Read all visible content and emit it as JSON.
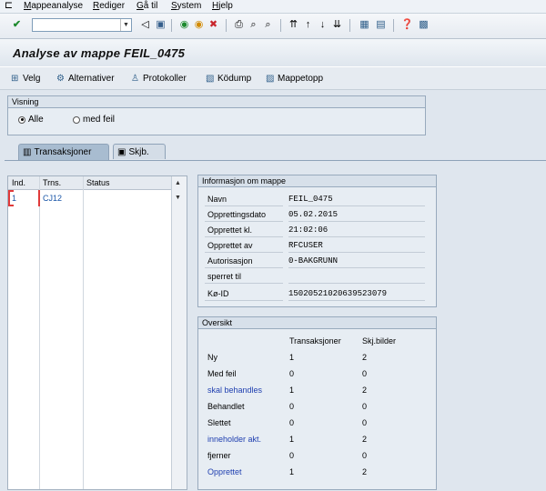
{
  "menu": {
    "items": [
      "Mappeanalyse",
      "Rediger",
      "Gå til",
      "System",
      "Hjelp"
    ]
  },
  "toolbar": {
    "command_value": ""
  },
  "title": "Analyse av mappe FEIL_0475",
  "app_toolbar": {
    "velg": "Velg",
    "alternativer": "Alternativer",
    "protokoller": "Protokoller",
    "kodump": "Ködump",
    "mappetopp": "Mappetopp"
  },
  "visning": {
    "title": "Visning",
    "alle": "Alle",
    "med_feil": "med feil",
    "selected": "Alle"
  },
  "tabs": {
    "transaksjoner": "Transaksjoner",
    "skjb": "Skjb."
  },
  "grid": {
    "headers": [
      "Ind.",
      "Trns.",
      "Status"
    ],
    "rows": [
      {
        "ind": "1",
        "trns": "CJ12",
        "status": ""
      }
    ]
  },
  "info": {
    "title": "Informasjon om mappe",
    "rows": [
      {
        "label": "Navn",
        "value": "FEIL_0475"
      },
      {
        "label": "Opprettingsdato",
        "value": "05.02.2015"
      },
      {
        "label": "Opprettet kl.",
        "value": "21:02:06"
      },
      {
        "label": "Opprettet av",
        "value": "RFCUSER"
      },
      {
        "label": "Autorisasjon",
        "value": "0-BAKGRUNN"
      },
      {
        "label": "sperret til",
        "value": ""
      },
      {
        "label": "Kø-ID",
        "value": "15020521020639523079"
      }
    ]
  },
  "oversikt": {
    "title": "Oversikt",
    "col1": "Transaksjoner",
    "col2": "Skj.bilder",
    "rows": [
      {
        "label": "Ny",
        "t": "1",
        "s": "2",
        "link": false
      },
      {
        "label": "Med feil",
        "t": "0",
        "s": "0",
        "link": false
      },
      {
        "label": "skal behandles",
        "t": "1",
        "s": "2",
        "link": true
      },
      {
        "label": "Behandlet",
        "t": "0",
        "s": "0",
        "link": false
      },
      {
        "label": "Slettet",
        "t": "0",
        "s": "0",
        "link": false
      },
      {
        "label": "inneholder akt.",
        "t": "1",
        "s": "2",
        "link": true
      },
      {
        "label": "fjerner",
        "t": "0",
        "s": "0",
        "link": false
      },
      {
        "label": "Opprettet",
        "t": "1",
        "s": "2",
        "link": true
      }
    ]
  },
  "colors": {
    "link": "#2040b0",
    "accent": "#1a56a8"
  }
}
